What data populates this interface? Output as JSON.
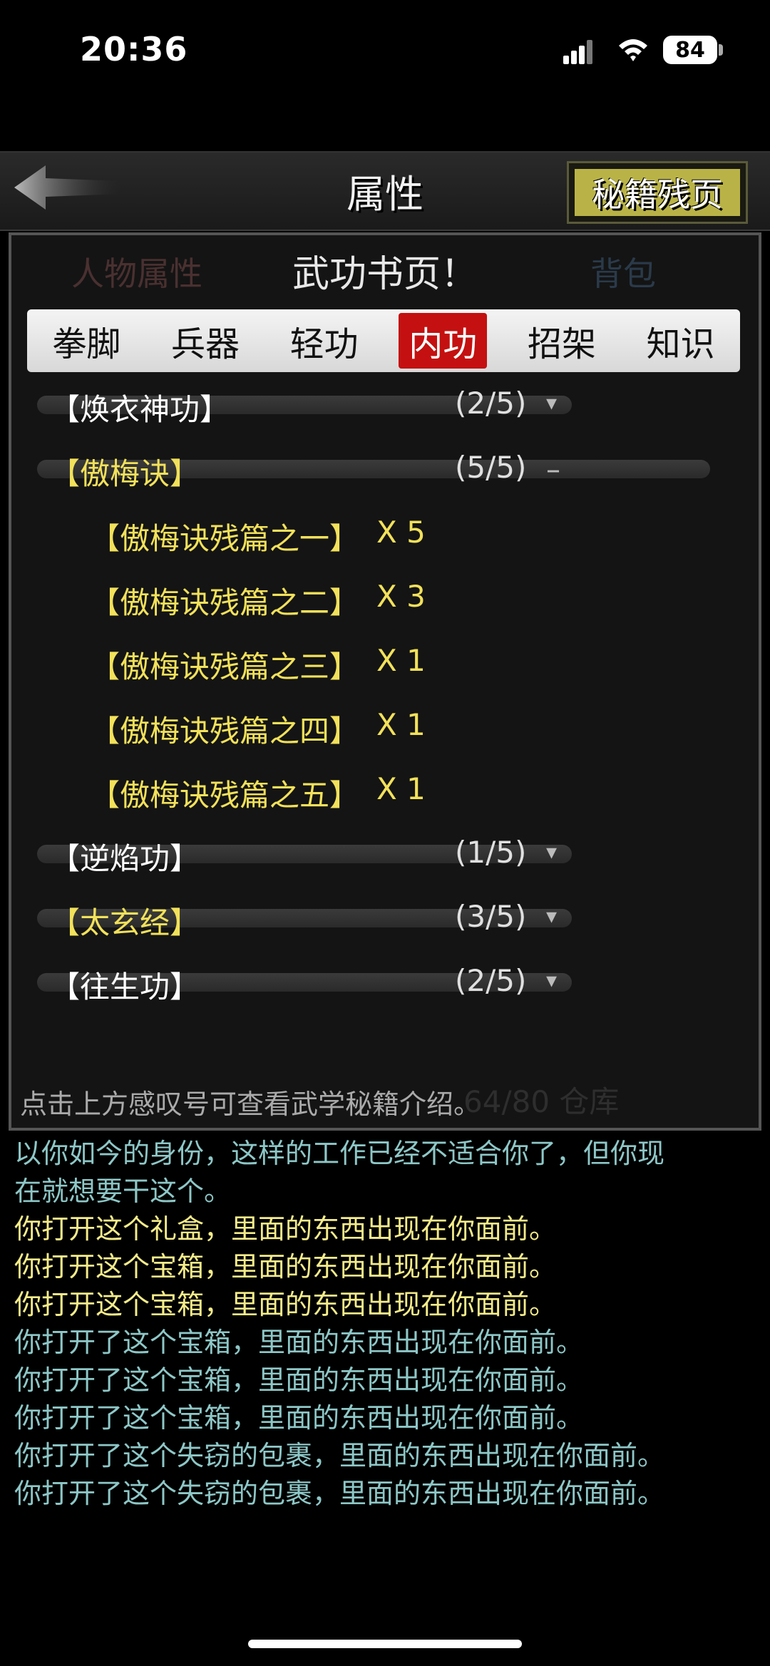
{
  "status_bar": {
    "time": "20:36",
    "battery": "84"
  },
  "header": {
    "title": "属性",
    "secret_pages_button": "秘籍残页"
  },
  "background_panel": {
    "person_tab": "人物属性",
    "bag_tab": "背包",
    "capacity": "64/80 仓库"
  },
  "dialog": {
    "title": "武功书页！",
    "tabs": [
      {
        "label": "拳脚",
        "active": false
      },
      {
        "label": "兵器",
        "active": false
      },
      {
        "label": "轻功",
        "active": false
      },
      {
        "label": "内功",
        "active": true
      },
      {
        "label": "招架",
        "active": false
      },
      {
        "label": "知识",
        "active": false
      }
    ],
    "skills": [
      {
        "name": "【焕衣神功】",
        "count": "(2/5)",
        "color": "#ffffff",
        "expanded": false
      },
      {
        "name": "【傲梅诀】",
        "count": "(5/5)",
        "color": "#f2e15a",
        "expanded": true,
        "fragments": [
          {
            "name": "【傲梅诀残篇之一】",
            "qty": "X 5"
          },
          {
            "name": "【傲梅诀残篇之二】",
            "qty": "X 3"
          },
          {
            "name": "【傲梅诀残篇之三】",
            "qty": "X 1"
          },
          {
            "name": "【傲梅诀残篇之四】",
            "qty": "X 1"
          },
          {
            "name": "【傲梅诀残篇之五】",
            "qty": "X 1"
          }
        ]
      },
      {
        "name": "【逆焰功】",
        "count": "(1/5)",
        "color": "#ffffff",
        "expanded": false
      },
      {
        "name": "【太玄经】",
        "count": "(3/5)",
        "color": "#f2e15a",
        "expanded": false
      },
      {
        "name": "【往生功】",
        "count": "(2/5)",
        "color": "#ffffff",
        "expanded": false
      }
    ],
    "hint": "点击上方感叹号可查看武学秘籍介绍。"
  },
  "log": [
    {
      "text": "以你如今的身份，这样的工作已经不适合你了，但你现",
      "color": "#8ec7c7"
    },
    {
      "text": "在就想要干这个。",
      "color": "#8ec7c7"
    },
    {
      "text": "你打开这个礼盒，里面的东西出现在你面前。",
      "color": "#f4ec8a"
    },
    {
      "text": "你打开这个宝箱，里面的东西出现在你面前。",
      "color": "#f4ec8a"
    },
    {
      "text": "你打开这个宝箱，里面的东西出现在你面前。",
      "color": "#f4ec8a"
    },
    {
      "text": "你打开了这个宝箱，里面的东西出现在你面前。",
      "color": "#8ec7c7"
    },
    {
      "text": "你打开了这个宝箱，里面的东西出现在你面前。",
      "color": "#8ec7c7"
    },
    {
      "text": "你打开了这个宝箱，里面的东西出现在你面前。",
      "color": "#8ec7c7"
    },
    {
      "text": "你打开了这个失窃的包裹，里面的东西出现在你面前。",
      "color": "#8ec7c7"
    },
    {
      "text": "你打开了这个失窃的包裹，里面的东西出现在你面前。",
      "color": "#8ec7c7"
    }
  ]
}
